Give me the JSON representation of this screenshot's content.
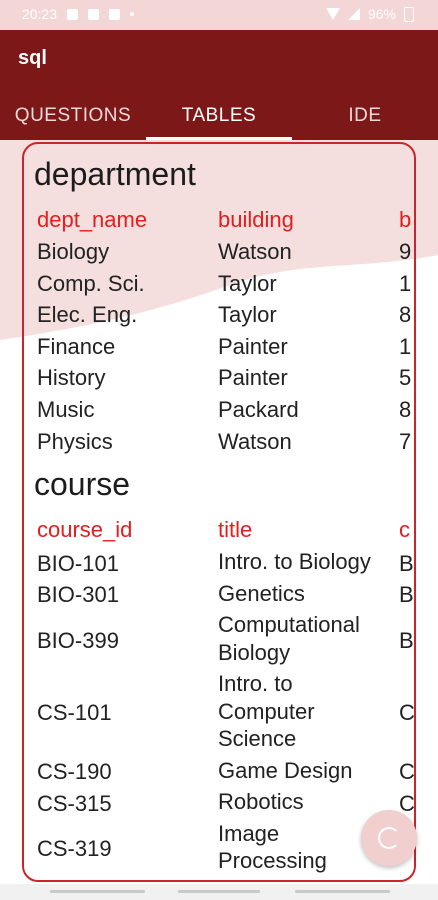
{
  "status_bar": {
    "time": "20:23",
    "battery": "96%"
  },
  "app": {
    "title": "sql"
  },
  "tabs": [
    {
      "label": "QUESTIONS",
      "active": false
    },
    {
      "label": "TABLES",
      "active": true
    },
    {
      "label": "IDE",
      "active": false
    }
  ],
  "tables": {
    "department": {
      "name": "department",
      "columns": [
        "dept_name",
        "building",
        "b"
      ],
      "rows": [
        [
          "Biology",
          "Watson",
          "9"
        ],
        [
          "Comp. Sci.",
          "Taylor",
          "1"
        ],
        [
          "Elec. Eng.",
          "Taylor",
          "8"
        ],
        [
          "Finance",
          "Painter",
          "1"
        ],
        [
          "History",
          "Painter",
          "5"
        ],
        [
          "Music",
          "Packard",
          "8"
        ],
        [
          "Physics",
          "Watson",
          "7"
        ]
      ]
    },
    "course": {
      "name": "course",
      "columns": [
        "course_id",
        "title",
        "c"
      ],
      "rows": [
        {
          "id": "BIO-101",
          "title": [
            "Intro. to Biology"
          ],
          "c": "B"
        },
        {
          "id": "BIO-301",
          "title": [
            "Genetics"
          ],
          "c": "B"
        },
        {
          "id": "BIO-399",
          "title": [
            "Computational",
            "Biology"
          ],
          "c": "B"
        },
        {
          "id": "CS-101",
          "title": [
            "Intro. to",
            "Computer",
            "Science"
          ],
          "c": "C"
        },
        {
          "id": "CS-190",
          "title": [
            "Game Design"
          ],
          "c": "C"
        },
        {
          "id": "CS-315",
          "title": [
            "Robotics"
          ],
          "c": "C"
        },
        {
          "id": "CS-319",
          "title": [
            "Image",
            "Processing"
          ],
          "c": ""
        }
      ]
    }
  },
  "fab": {
    "icon": "refresh-icon"
  },
  "colors": {
    "app_bar": "#7d1818",
    "accent_red": "#e41d1d",
    "card_border": "#c8262a",
    "background_wave": "#f4dede"
  }
}
